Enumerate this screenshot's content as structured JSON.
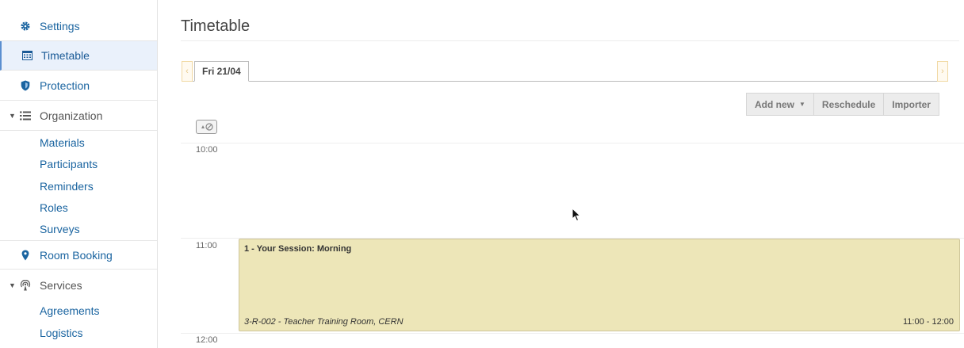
{
  "sidebar": {
    "items": [
      {
        "label": "Settings",
        "icon": "gear-icon"
      },
      {
        "label": "Timetable",
        "icon": "calendar-icon",
        "active": true
      },
      {
        "label": "Protection",
        "icon": "shield-icon"
      },
      {
        "label": "Organization",
        "icon": "list-icon",
        "expanded": true
      },
      {
        "label": "Room Booking",
        "icon": "map-pin-icon"
      },
      {
        "label": "Services",
        "icon": "broadcast-icon",
        "expanded": true
      }
    ],
    "organization_children": [
      "Materials",
      "Participants",
      "Reminders",
      "Roles",
      "Surveys"
    ],
    "services_children": [
      "Agreements",
      "Logistics"
    ]
  },
  "main": {
    "title": "Timetable",
    "day_tab": "Fri 21/04",
    "toolbar": {
      "add_new": "Add new",
      "reschedule": "Reschedule",
      "importer": "Importer"
    },
    "times": [
      "10:00",
      "11:00",
      "12:00"
    ],
    "session": {
      "title": "1 - Your Session: Morning",
      "room": "3-R-002 - Teacher Training Room, CERN",
      "time": "11:00 - 12:00",
      "color": "#ede6b8"
    }
  },
  "colors": {
    "link": "#1a64a0",
    "active_bg": "#eaf1fb"
  }
}
